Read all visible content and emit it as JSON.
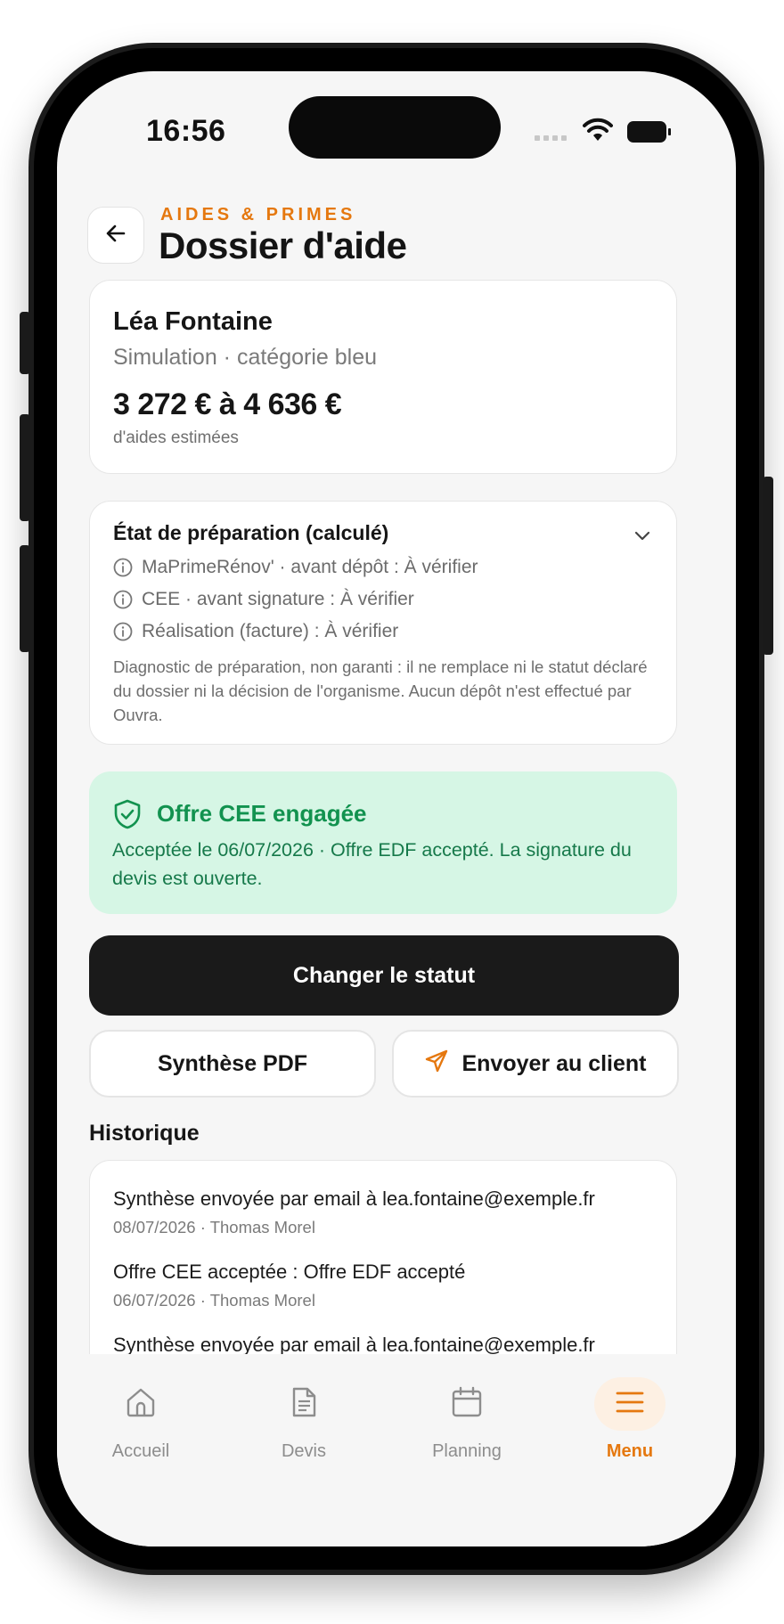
{
  "status_bar": {
    "time": "16:56"
  },
  "header": {
    "eyebrow": "AIDES & PRIMES",
    "title": "Dossier d'aide"
  },
  "client": {
    "name": "Léa Fontaine",
    "subtitle": "Simulation · catégorie bleu",
    "amount": "3 272 € à 4 636 €",
    "amount_label": "d'aides estimées"
  },
  "readiness": {
    "title": "État de préparation (calculé)",
    "rows": [
      "MaPrimeRénov' · avant dépôt : À vérifier",
      "CEE · avant signature : À vérifier",
      "Réalisation (facture) : À vérifier"
    ],
    "note": "Diagnostic de préparation, non garanti : il ne remplace ni le statut déclaré du dossier ni la décision de l'organisme. Aucun dépôt n'est effectué par Ouvra."
  },
  "offer": {
    "title": "Offre CEE engagée",
    "text": "Acceptée le 06/07/2026 · Offre EDF accepté. La signature du devis est ouverte."
  },
  "actions": {
    "primary": "Changer le statut",
    "pdf": "Synthèse PDF",
    "send": "Envoyer au client"
  },
  "history": {
    "title": "Historique",
    "items": [
      {
        "text": "Synthèse envoyée par email à lea.fontaine@exemple.fr",
        "meta": "08/07/2026 · Thomas Morel"
      },
      {
        "text": "Offre CEE acceptée : Offre EDF accepté",
        "meta": "06/07/2026 · Thomas Morel"
      },
      {
        "text": "Synthèse envoyée par email à lea.fontaine@exemple.fr",
        "meta": ""
      }
    ]
  },
  "tabs": [
    {
      "label": "Accueil",
      "icon": "home-icon"
    },
    {
      "label": "Devis",
      "icon": "document-icon"
    },
    {
      "label": "Planning",
      "icon": "calendar-icon"
    },
    {
      "label": "Menu",
      "icon": "menu-icon"
    }
  ],
  "colors": {
    "accent": "#e5780f",
    "success_bg": "#d6f6e5",
    "success_text": "#12924f",
    "primary_button": "#1a1a1a"
  }
}
